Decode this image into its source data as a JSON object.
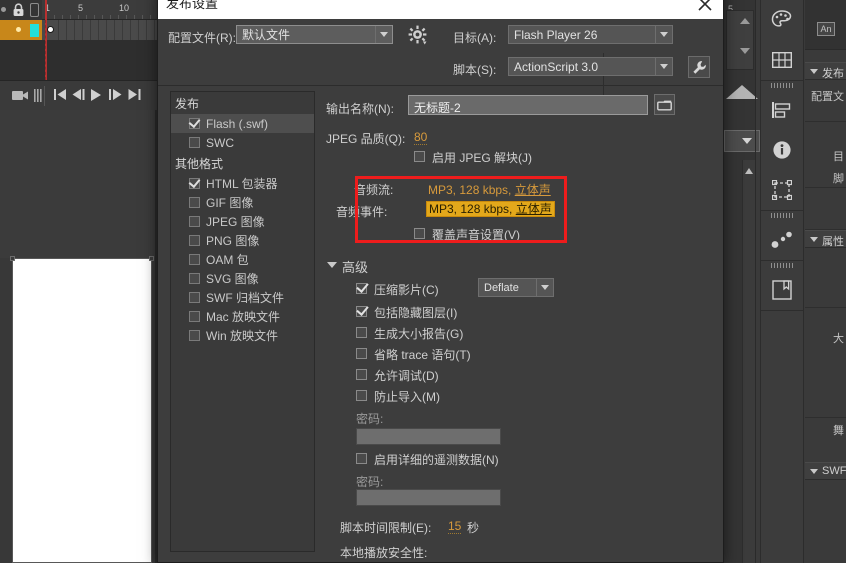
{
  "app": {
    "timeline": {
      "frame_numbers": [
        "1",
        "5",
        "10"
      ],
      "controls": [
        "camera-icon",
        "onion-skin-icon",
        "go-to-start-icon",
        "step-back-icon",
        "play-icon",
        "step-forward-icon",
        "go-to-end-icon"
      ]
    },
    "dock_icons": [
      "color-palette-icon",
      "swatches-grid-icon",
      "align-icon",
      "info-icon",
      "transform-icon",
      "motion-editor-icon",
      "library-icon"
    ],
    "properties": {
      "badge": "An",
      "sections": [
        {
          "label": "发布"
        },
        {
          "label": "属性"
        },
        {
          "label": "SWF"
        }
      ],
      "rows": [
        "配置文",
        "目",
        "脚",
        "大",
        "舞"
      ]
    }
  },
  "dialog": {
    "title": "发布设置",
    "close_icon": "close-icon",
    "profile": {
      "label": "配置文件(R):",
      "value": "默认文件",
      "gear_icon": "gear-icon"
    },
    "target": {
      "label": "目标(A):",
      "value": "Flash Player 26"
    },
    "script": {
      "label": "脚本(S):",
      "value": "ActionScript 3.0",
      "wrench_icon": "wrench-icon"
    },
    "formats": {
      "groups": [
        {
          "title": "发布",
          "items": [
            {
              "label": "Flash (.swf)",
              "checked": true,
              "selected": true
            },
            {
              "label": "SWC",
              "checked": false,
              "selected": false
            }
          ]
        },
        {
          "title": "其他格式",
          "items": [
            {
              "label": "HTML 包装器",
              "checked": true,
              "selected": false
            },
            {
              "label": "GIF 图像",
              "checked": false,
              "selected": false
            },
            {
              "label": "JPEG 图像",
              "checked": false,
              "selected": false
            },
            {
              "label": "PNG 图像",
              "checked": false,
              "selected": false
            },
            {
              "label": "OAM 包",
              "checked": false,
              "selected": false
            },
            {
              "label": "SVG 图像",
              "checked": false,
              "selected": false
            },
            {
              "label": "SWF 归档文件",
              "checked": false,
              "selected": false
            },
            {
              "label": "Mac 放映文件",
              "checked": false,
              "selected": false
            },
            {
              "label": "Win 放映文件",
              "checked": false,
              "selected": false
            }
          ]
        }
      ]
    },
    "output": {
      "label": "输出名称(N):",
      "value": "无标题-2",
      "folder_icon": "folder-icon"
    },
    "jpeg_quality": {
      "label": "JPEG 品质(Q):",
      "value": "80"
    },
    "jpeg_deblock": {
      "label": "启用 JPEG 解块(J)",
      "checked": false
    },
    "audio_stream": {
      "label": "音频流:",
      "value_prefix": "MP3, 128 kbps, ",
      "value_link": "立体声"
    },
    "audio_event": {
      "label": "音频事件:",
      "value_prefix": "MP3, 128 kbps, ",
      "value_link": "立体声"
    },
    "override_sound": {
      "label": "覆盖声音设置(V)",
      "checked": false
    },
    "advanced": {
      "title": "高级",
      "compress_movie": {
        "label": "压缩影片(C)",
        "checked": true,
        "value": "Deflate"
      },
      "options": [
        {
          "label": "包括隐藏图层(I)",
          "checked": true
        },
        {
          "label": "生成大小报告(G)",
          "checked": false
        },
        {
          "label": "省略 trace 语句(T)",
          "checked": false
        },
        {
          "label": "允许调试(D)",
          "checked": false
        },
        {
          "label": "防止导入(M)",
          "checked": false
        }
      ],
      "password_label_1": "密码:",
      "password_value_1": "",
      "telemetry": {
        "label": "启用详细的遥测数据(N)",
        "checked": false
      },
      "password_label_2": "密码:",
      "password_value_2": "",
      "script_time_limit": {
        "label": "脚本时间限制(E):",
        "value": "15",
        "unit": "秒"
      },
      "local_playback": {
        "label": "本地播放安全性:"
      }
    }
  },
  "annotation": {
    "color": "#ee1c1c",
    "name": "audio-settings-highlight-box"
  }
}
